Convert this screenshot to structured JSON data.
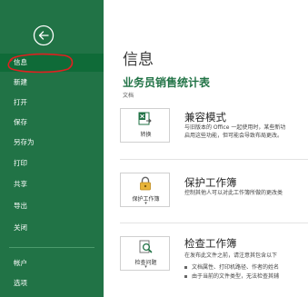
{
  "nav": {
    "back_icon": "back-arrow-icon",
    "items": [
      {
        "label": "信息",
        "selected": true
      },
      {
        "label": "新建"
      },
      {
        "label": "打开"
      },
      {
        "label": "保存"
      },
      {
        "label": "另存为"
      },
      {
        "label": "打印"
      },
      {
        "label": "共享"
      },
      {
        "label": "导出"
      },
      {
        "label": "关闭"
      },
      {
        "label": "帐户"
      },
      {
        "label": "选项"
      }
    ],
    "colors": {
      "background": "#217346",
      "selected": "#0f6b38",
      "annotation": "#e02020"
    }
  },
  "main": {
    "title": "信息",
    "doc_name": "业务员销售统计表",
    "doc_path": "文档",
    "compat": {
      "tile_label": "转换",
      "icon": "convert-icon",
      "title": "兼容模式",
      "desc1": "与旧版本的 Office 一起使用时，某些新功",
      "desc2": "启用这些功能，但可能会导致布局更改。"
    },
    "protect": {
      "tile_label": "保护工作簿",
      "caret": "▾",
      "icon": "lock-icon",
      "title": "保护工作簿",
      "desc": "控制其他人可以对此工作簿所做的更改类"
    },
    "inspect": {
      "tile_label": "检查问题",
      "caret": "▾",
      "icon": "inspect-icon",
      "title": "检查工作簿",
      "desc": "在发布此文件之前，请注意其包含以下",
      "bullet1": "文档属性、打印机路径、作者的姓名",
      "bullet2": "由于当前的文件类型，无法检查其辅"
    }
  }
}
